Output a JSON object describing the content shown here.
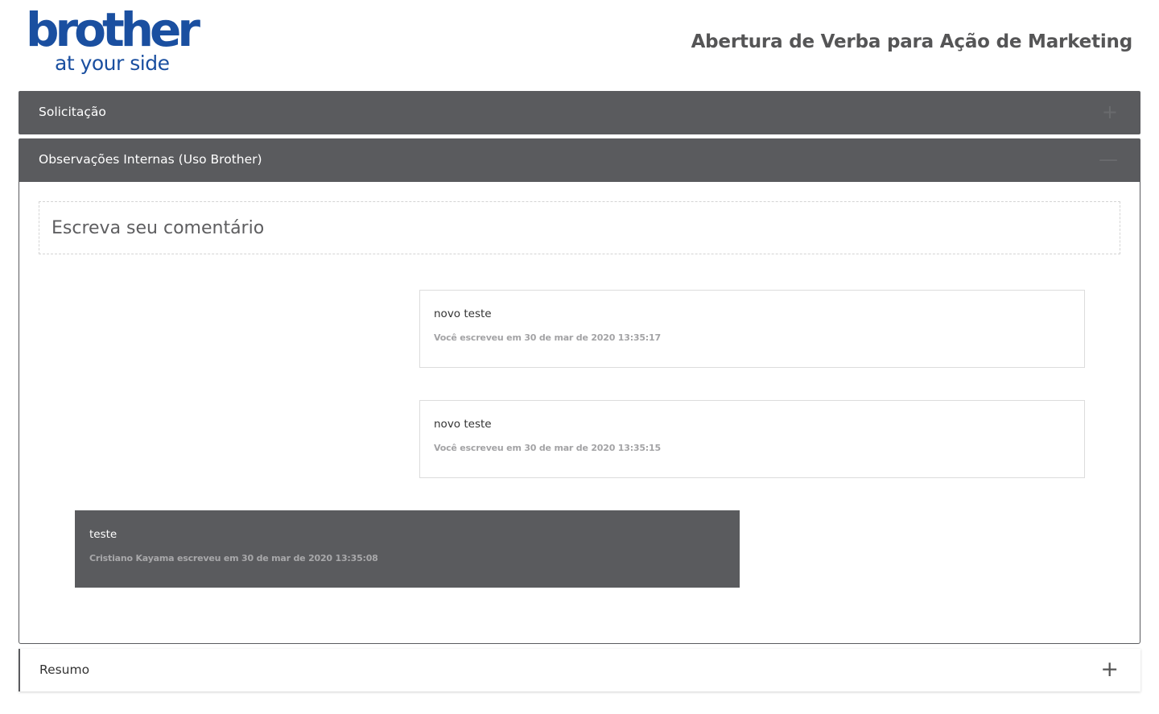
{
  "header": {
    "logo_word": "brother",
    "logo_tagline": "at your side",
    "page_title": "Abertura de Verba para Ação de Marketing"
  },
  "panels": {
    "solicitacao": {
      "label": "Solicitação",
      "icon": "plus-icon",
      "toggle_glyph": "+"
    },
    "observacoes": {
      "label": "Observações Internas (Uso Brother)",
      "icon": "minus-icon",
      "toggle_glyph": "—"
    },
    "resumo": {
      "label": "Resumo",
      "icon": "plus-icon",
      "toggle_glyph": "+"
    }
  },
  "comment_box": {
    "placeholder": "Escreva seu comentário",
    "value": ""
  },
  "comments": [
    {
      "text": "novo teste",
      "meta": "Você escreveu em 30 de mar de 2020 13:35:17",
      "own": true
    },
    {
      "text": "novo teste",
      "meta": "Você escreveu em 30 de mar de 2020 13:35:15",
      "own": true
    },
    {
      "text": "teste",
      "meta": "Cristiano Kayama escreveu em 30 de mar de 2020 13:35:08",
      "own": false
    }
  ],
  "colors": {
    "brand_blue": "#1a4fa0",
    "panel_header_bg": "#5a5b5e",
    "meta_text": "#a3a3a5"
  }
}
